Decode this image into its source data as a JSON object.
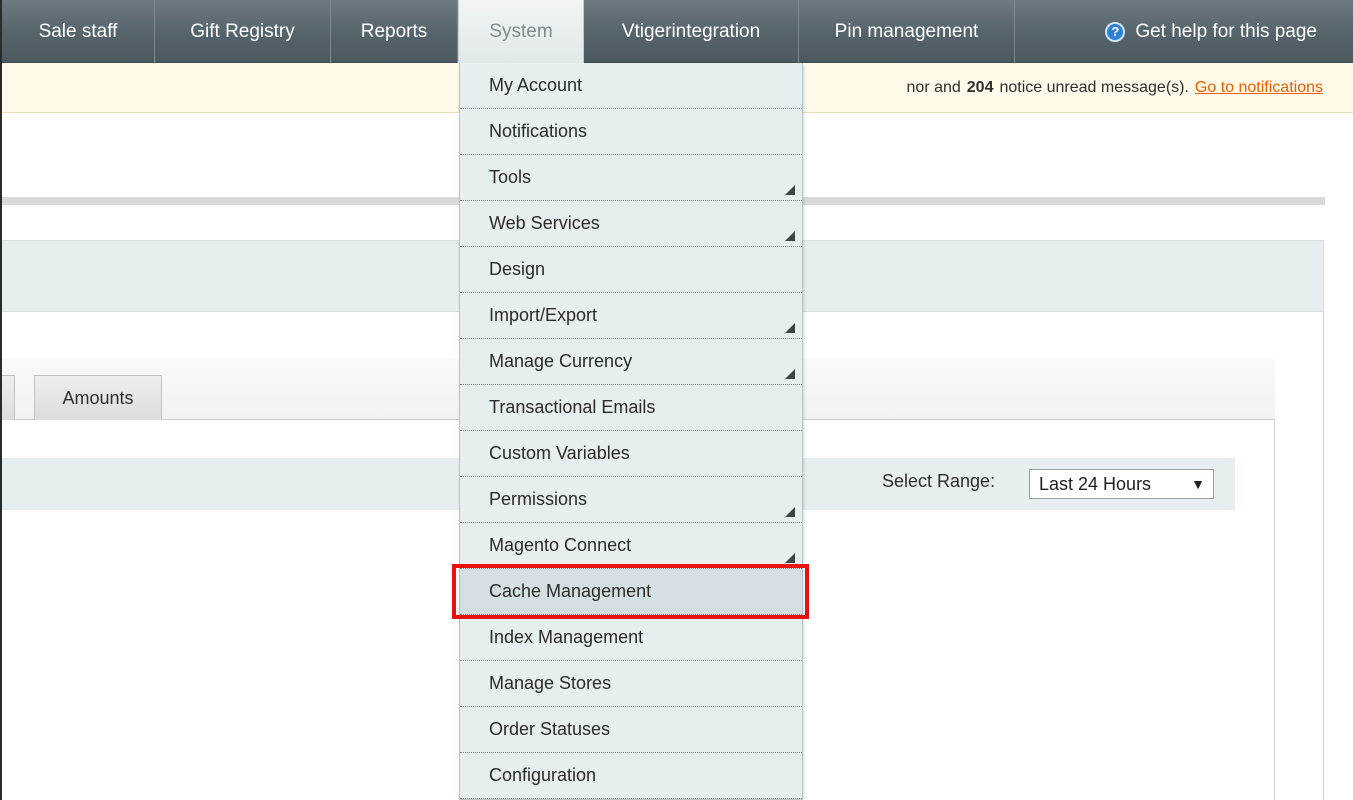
{
  "nav": {
    "items": [
      {
        "label": "Sale staff"
      },
      {
        "label": "Gift Registry"
      },
      {
        "label": "Reports"
      },
      {
        "label": "System"
      },
      {
        "label": "Vtigerintegration"
      },
      {
        "label": "Pin management"
      }
    ],
    "active_item": "System",
    "help_label": "Get help for this page",
    "help_icon": "question-circle-icon"
  },
  "notice": {
    "prefix": "nor and",
    "count": "204",
    "suffix": "notice unread message(s).",
    "link_label": "Go to notifications"
  },
  "tabs": {
    "amounts_label": "Amounts"
  },
  "filter": {
    "range_label": "Select Range:",
    "range_value": "Last 24 Hours",
    "dropdown_glyph": "▼"
  },
  "system_menu": {
    "items": [
      {
        "label": "My Account",
        "has_submenu": false
      },
      {
        "label": "Notifications",
        "has_submenu": false
      },
      {
        "label": "Tools",
        "has_submenu": true
      },
      {
        "label": "Web Services",
        "has_submenu": true
      },
      {
        "label": "Design",
        "has_submenu": false
      },
      {
        "label": "Import/Export",
        "has_submenu": true
      },
      {
        "label": "Manage Currency",
        "has_submenu": true
      },
      {
        "label": "Transactional Emails",
        "has_submenu": false
      },
      {
        "label": "Custom Variables",
        "has_submenu": false
      },
      {
        "label": "Permissions",
        "has_submenu": true
      },
      {
        "label": "Magento Connect",
        "has_submenu": true
      },
      {
        "label": "Cache Management",
        "has_submenu": false
      },
      {
        "label": "Index Management",
        "has_submenu": false
      },
      {
        "label": "Manage Stores",
        "has_submenu": false
      },
      {
        "label": "Order Statuses",
        "has_submenu": false
      },
      {
        "label": "Configuration",
        "has_submenu": false
      }
    ],
    "highlighted_item": "Cache Management"
  },
  "colors": {
    "navbar": "#55636a",
    "menu_background": "#e6eef0",
    "highlight_border": "#e8120c",
    "notice_link": "#eb5e00"
  }
}
